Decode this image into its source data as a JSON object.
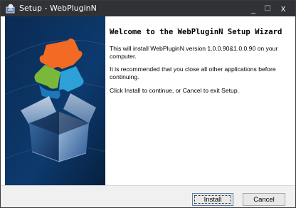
{
  "window": {
    "title": "Setup - WebPluginN",
    "controls": {
      "minimize": "_",
      "maximize": "□",
      "close": "x"
    }
  },
  "banner": {
    "image": "open-box-with-puzzle-pieces"
  },
  "content": {
    "heading": "Welcome to the WebPluginN Setup Wizard",
    "paragraphs": [
      "This will install WebPluginN version 1.0.0.90&1.0.0.90 on your computer.",
      "It is recommended that you close all other applications before continuing.",
      "Click Install to continue, or Cancel to exit Setup."
    ]
  },
  "buttons": {
    "install": "Install",
    "cancel": "Cancel"
  },
  "colors": {
    "titlebar": "#303236",
    "banner": "#0b2d55",
    "footer": "#f0f0f0"
  }
}
